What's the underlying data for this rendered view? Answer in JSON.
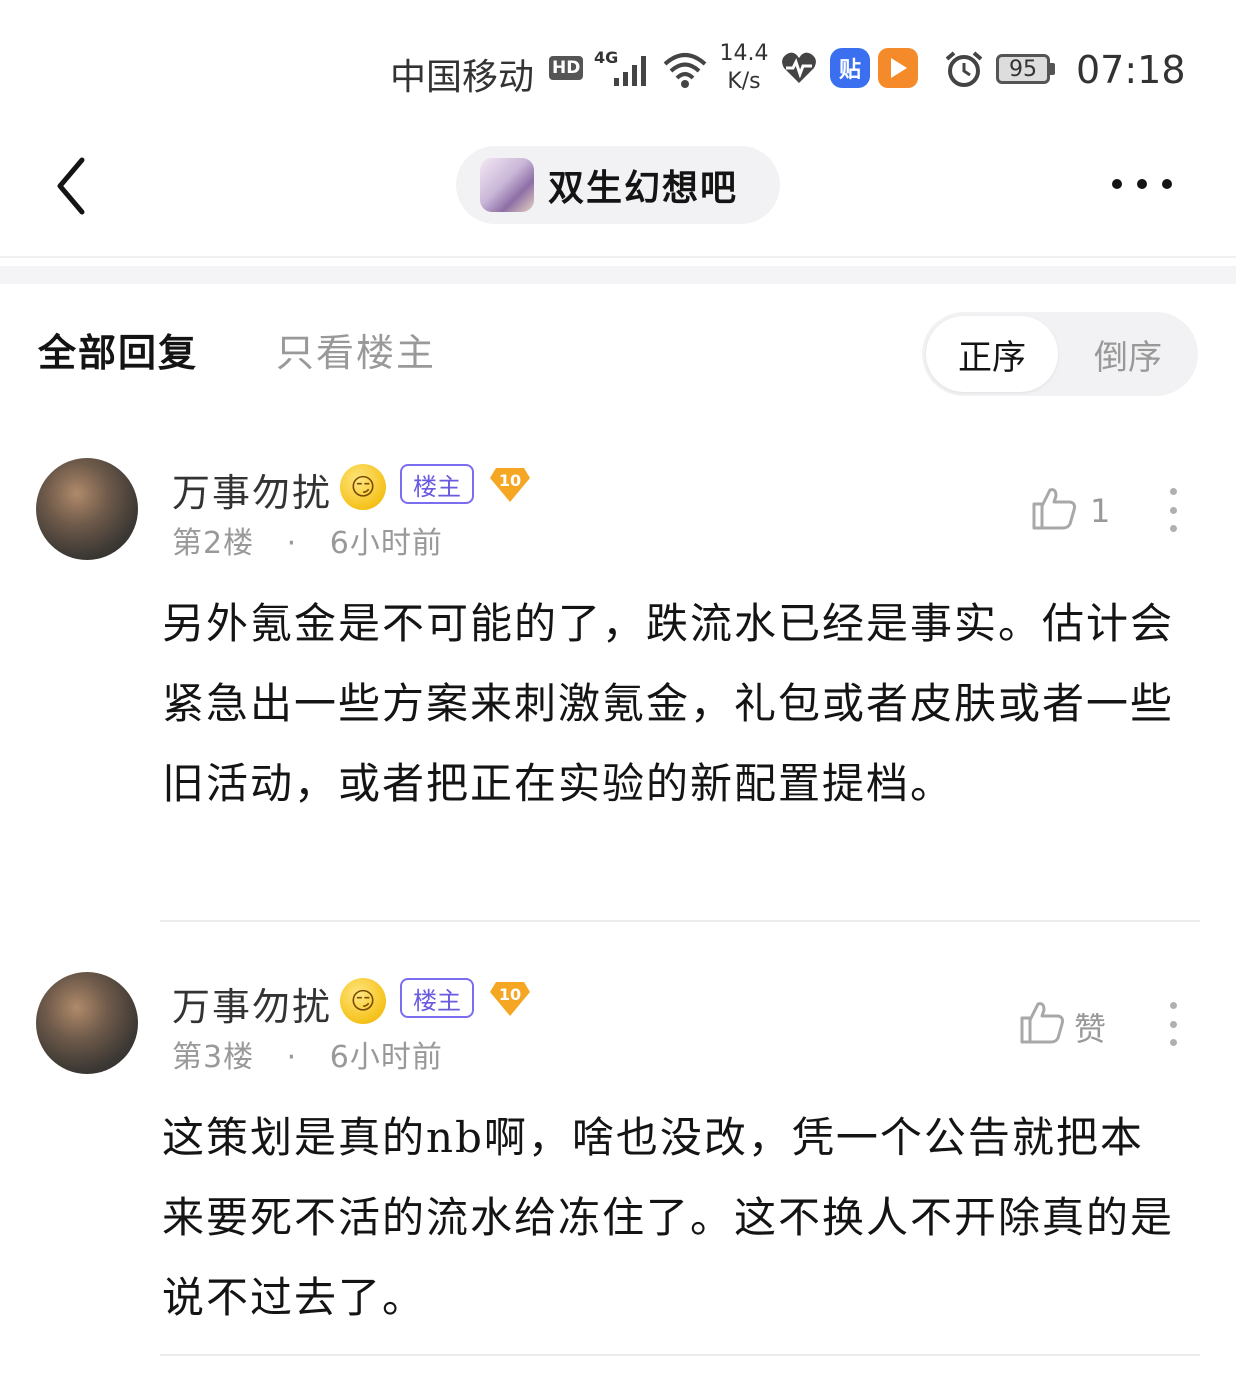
{
  "status_bar": {
    "carrier": "中国移动",
    "hd": "HD",
    "network": "4G",
    "speed_value": "14.4",
    "speed_unit": "K/s",
    "tieba_app": "贴",
    "battery": "95",
    "time": "07:18"
  },
  "nav": {
    "forum_name": "双生幻想吧"
  },
  "tabs": {
    "all_replies": "全部回复",
    "op_only": "只看楼主",
    "sort_asc": "正序",
    "sort_desc": "倒序"
  },
  "posts": [
    {
      "username": "万事勿扰",
      "emoji": "😏",
      "op_badge": "楼主",
      "level": "10",
      "floor": "第2楼",
      "time": "6小时前",
      "likes": "1",
      "body": "另外氪金是不可能的了，跌流水已经是事实。估计会紧急出一些方案来刺激氪金，礼包或者皮肤或者一些旧活动，或者把正在实验的新配置提档。"
    },
    {
      "username": "万事勿扰",
      "emoji": "😏",
      "op_badge": "楼主",
      "level": "10",
      "floor": "第3楼",
      "time": "6小时前",
      "like_label": "赞",
      "body": "这策划是真的nb啊，啥也没改，凭一个公告就把本来要死不活的流水给冻住了。这不换人不开除真的是说不过去了。"
    }
  ],
  "colors": {
    "op_badge": "#6a5ae0",
    "level_badge": "#f5a623",
    "muted_text": "#999999"
  }
}
